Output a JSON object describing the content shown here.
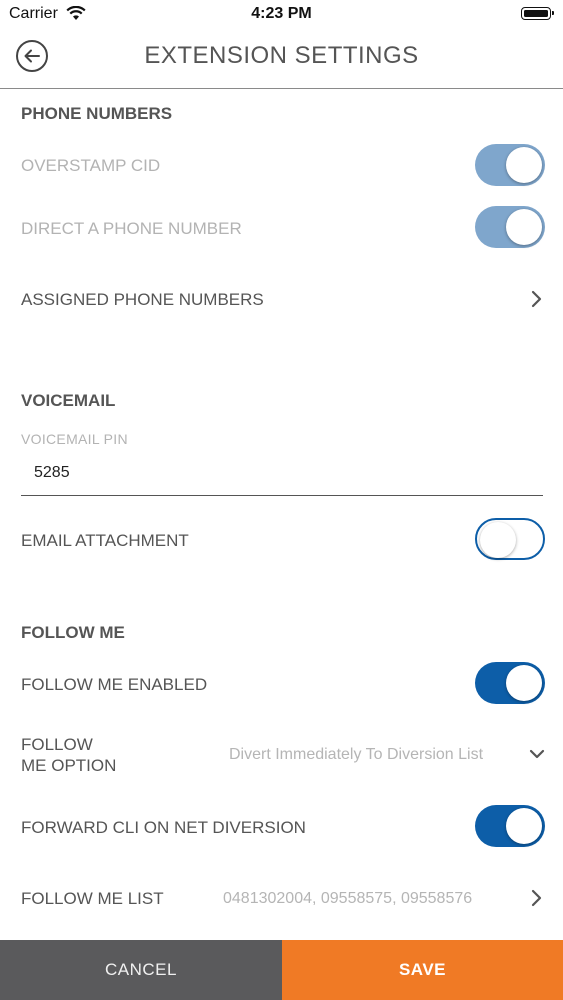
{
  "status_bar": {
    "carrier": "Carrier",
    "time": "4:23 PM"
  },
  "header": {
    "title": "EXTENSION SETTINGS",
    "back_icon": "back-arrow-circle-icon"
  },
  "phone_numbers": {
    "section_title": "PHONE NUMBERS",
    "overstamp_cid": {
      "label": "OVERSTAMP CID",
      "enabled": true,
      "disabled": true
    },
    "direct_phone_number": {
      "label": "DIRECT A PHONE NUMBER",
      "enabled": true,
      "disabled": true
    },
    "assigned_phone_numbers": {
      "label": "ASSIGNED PHONE NUMBERS"
    }
  },
  "voicemail": {
    "section_title": "VOICEMAIL",
    "pin_label": "VOICEMAIL PIN",
    "pin_value": "5285",
    "email_attachment": {
      "label": "EMAIL ATTACHMENT",
      "enabled": false
    }
  },
  "follow_me": {
    "section_title": "FOLLOW ME",
    "enabled_row": {
      "label": "FOLLOW ME ENABLED",
      "enabled": true
    },
    "option_row": {
      "label_line1": "FOLLOW",
      "label_line2": "ME OPTION",
      "value": "Divert Immediately To Diversion List"
    },
    "forward_cli": {
      "label": "FORWARD CLI ON NET DIVERSION",
      "enabled": true
    },
    "list_row": {
      "label": "FOLLOW ME LIST",
      "value": "0481302004, 09558575, 09558576"
    }
  },
  "footer": {
    "cancel_label": "CANCEL",
    "save_label": "SAVE"
  },
  "colors": {
    "toggle_active": "#0d5ea8",
    "toggle_dim": "#7fa6cc",
    "save_button": "#f07a25",
    "cancel_button": "#5a5a5c"
  }
}
